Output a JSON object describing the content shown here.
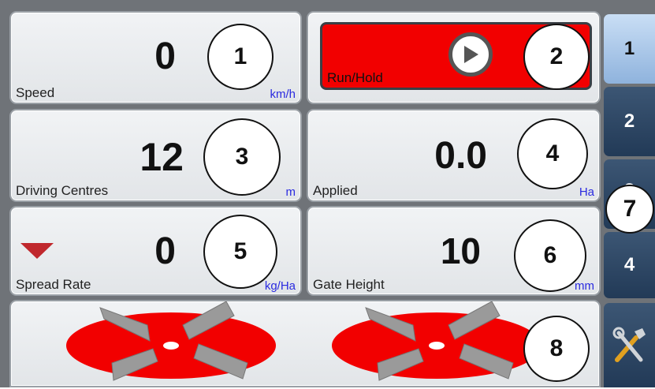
{
  "tiles": {
    "speed": {
      "value": "0",
      "label": "Speed",
      "unit": "km/h"
    },
    "run_hold": {
      "label": "Run/Hold"
    },
    "driving_centres": {
      "value": "12",
      "label": "Driving Centres",
      "unit": "m"
    },
    "applied": {
      "value": "0.0",
      "label": "Applied",
      "unit": "Ha"
    },
    "spread_rate": {
      "value": "0",
      "label": "Spread Rate",
      "unit": "kg/Ha"
    },
    "gate_height": {
      "value": "10",
      "label": "Gate Height",
      "unit": "mm"
    }
  },
  "side_tabs": [
    {
      "label": "1",
      "active": true
    },
    {
      "label": "2",
      "active": false
    },
    {
      "label": "3",
      "active": false
    },
    {
      "label": "4",
      "active": false
    }
  ],
  "settings_icon": "tools-icon",
  "callouts": [
    "1",
    "2",
    "3",
    "4",
    "5",
    "6",
    "7",
    "8"
  ],
  "colors": {
    "run_hold_bg": "#f20000",
    "spinner_disc": "#f20000",
    "tab_active": "#a9c8ec",
    "tab_inactive": "#2c4664",
    "unit_text": "#2a2ae0",
    "decrease_arrow": "#c0282d"
  }
}
